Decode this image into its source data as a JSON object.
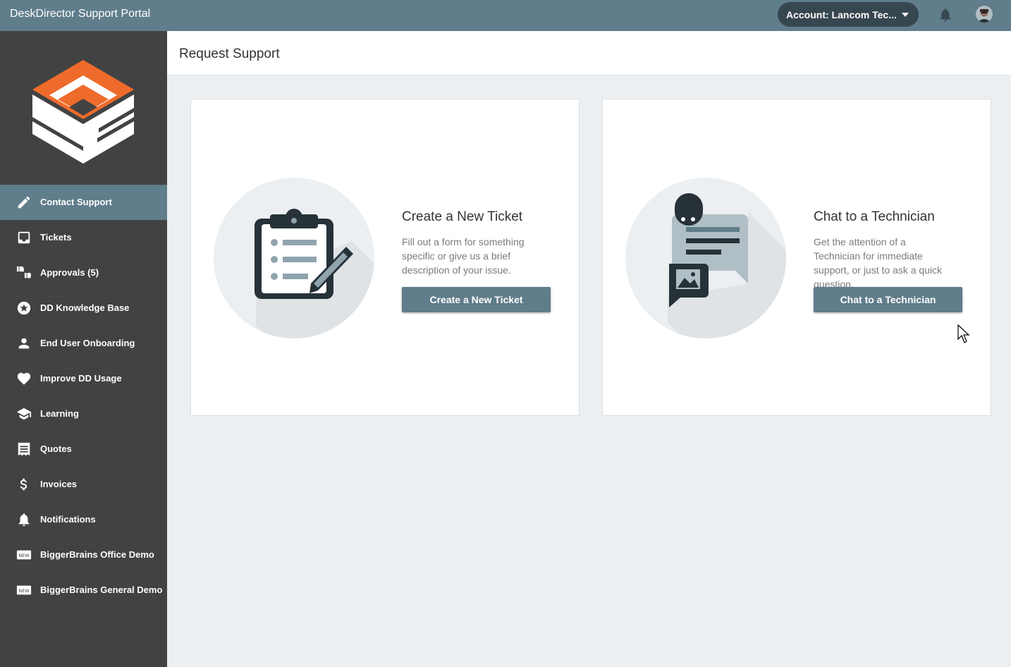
{
  "app": {
    "title": "DeskDirector Support Portal"
  },
  "topbar": {
    "account_label": "Account: Lancom Tec...",
    "icons": {
      "notifications": "bell-icon",
      "profile": "avatar"
    }
  },
  "sidebar": {
    "items": [
      {
        "label": "Contact Support",
        "icon": "pencil-icon",
        "active": true
      },
      {
        "label": "Tickets",
        "icon": "inbox-icon",
        "active": false
      },
      {
        "label": "Approvals (5)",
        "icon": "thumbs-icon",
        "active": false
      },
      {
        "label": "DD Knowledge Base",
        "icon": "star-badge-icon",
        "active": false
      },
      {
        "label": "End User Onboarding",
        "icon": "person-icon",
        "active": false
      },
      {
        "label": "Improve DD Usage",
        "icon": "heart-icon",
        "active": false
      },
      {
        "label": "Learning",
        "icon": "graduation-cap-icon",
        "active": false
      },
      {
        "label": "Quotes",
        "icon": "receipt-icon",
        "active": false
      },
      {
        "label": "Invoices",
        "icon": "dollar-icon",
        "active": false
      },
      {
        "label": "Notifications",
        "icon": "bell-icon",
        "active": false
      },
      {
        "label": "BiggerBrains Office Demo",
        "icon": "new-badge-icon",
        "active": false
      },
      {
        "label": "BiggerBrains General Demo",
        "icon": "new-badge-icon",
        "active": false
      }
    ]
  },
  "page": {
    "title": "Request Support"
  },
  "cards": [
    {
      "title": "Create a New Ticket",
      "description": "Fill out a form for something specific or give us a brief description of your issue.",
      "button_label": "Create a New Ticket",
      "icon": "clipboard-icon"
    },
    {
      "title": "Chat to a Technician",
      "description": "Get the attention of a Technician for immediate support, or just to ask a quick question.",
      "button_label": "Chat to a Technician",
      "icon": "chat-icon"
    }
  ],
  "colors": {
    "topbar": "#607d8b",
    "sidebar": "#424242",
    "active_item": "#607d8b",
    "account_pill": "#37474f",
    "button": "#607d8b",
    "logo_orange": "#ee6b2b",
    "background": "#eceff1"
  }
}
